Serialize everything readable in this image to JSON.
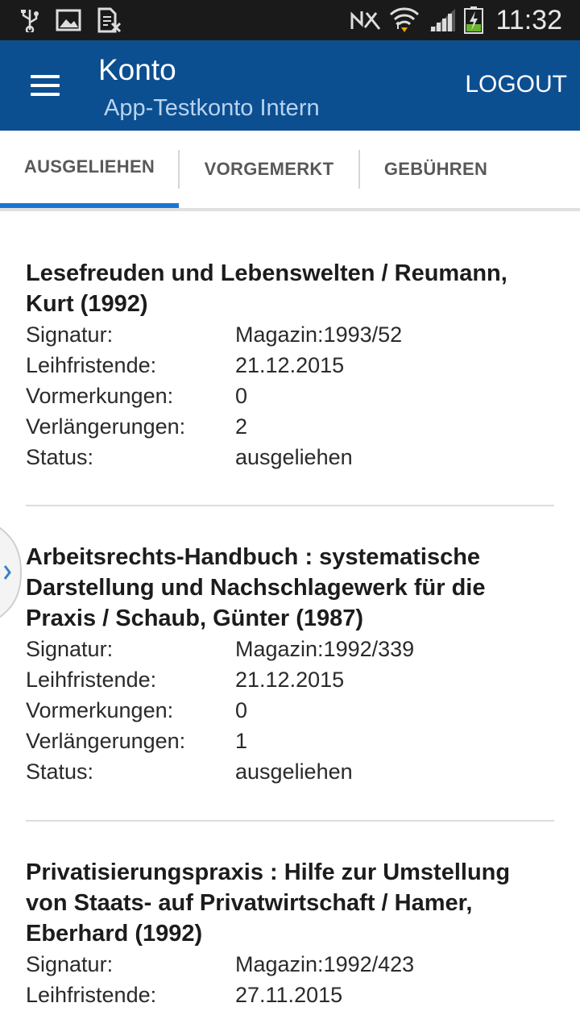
{
  "statusbar": {
    "time": "11:32",
    "icons": [
      "usb-icon",
      "image-icon",
      "sim-off-icon",
      "nfc-mute-icon",
      "wifi-icon",
      "signal-icon",
      "battery-charging-icon"
    ]
  },
  "appbar": {
    "title": "Konto",
    "subtitle": "App-Testkonto Intern",
    "logout_label": "LOGOUT",
    "menu_icon": "hamburger-menu-icon",
    "bg_color": "#0c4f91"
  },
  "tabs": [
    {
      "label": "AUSGELIEHEN",
      "active": true
    },
    {
      "label": "VORGEMERKT",
      "active": false
    },
    {
      "label": "GEBÜHREN",
      "active": false
    }
  ],
  "accent_color": "#1976d2",
  "items": [
    {
      "title": "Lesefreuden und Lebenswelten / Reumann, Kurt (1992)",
      "fields": [
        {
          "label": "Signatur:",
          "value": "Magazin:1993/52"
        },
        {
          "label": "Leihfristende:",
          "value": "21.12.2015"
        },
        {
          "label": "Vormerkungen:",
          "value": "0"
        },
        {
          "label": "Verlängerungen:",
          "value": "2"
        },
        {
          "label": "Status:",
          "value": "ausgeliehen"
        }
      ]
    },
    {
      "title": "Arbeitsrechts-Handbuch : systematische Darstellung und Nachschlagewerk für die Praxis / Schaub, Günter (1987)",
      "fields": [
        {
          "label": "Signatur:",
          "value": "Magazin:1992/339"
        },
        {
          "label": "Leihfristende:",
          "value": "21.12.2015"
        },
        {
          "label": "Vormerkungen:",
          "value": "0"
        },
        {
          "label": "Verlängerungen:",
          "value": "1"
        },
        {
          "label": "Status:",
          "value": "ausgeliehen"
        }
      ]
    },
    {
      "title": "Privatisierungspraxis : Hilfe zur Umstellung von Staats- auf Privatwirtschaft / Hamer, Eberhard (1992)",
      "fields": [
        {
          "label": "Signatur:",
          "value": "Magazin:1992/423"
        },
        {
          "label": "Leihfristende:",
          "value": "27.11.2015"
        }
      ]
    }
  ]
}
